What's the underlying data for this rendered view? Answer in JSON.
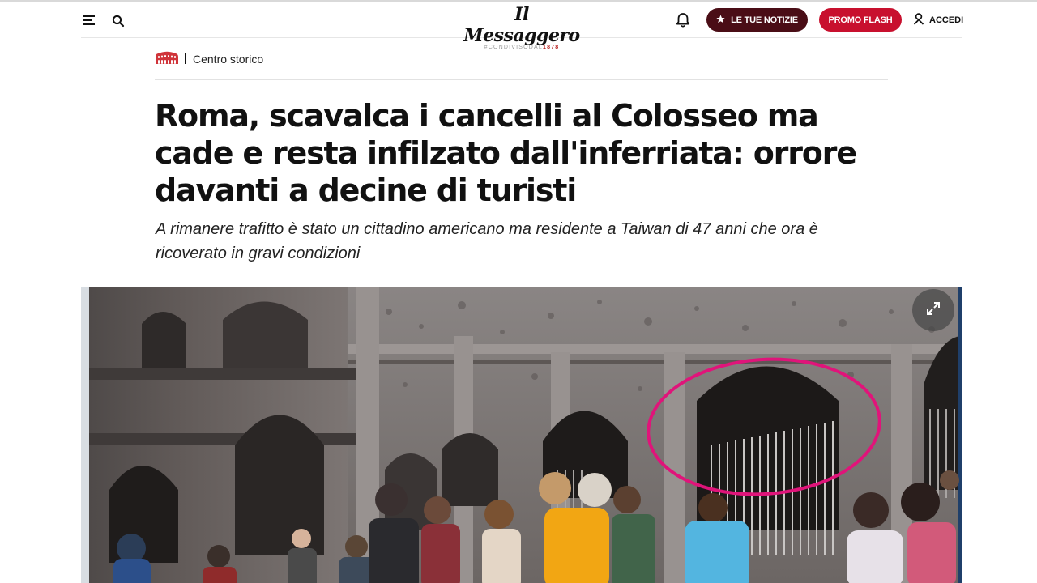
{
  "header": {
    "logo_title": "Il Messaggero",
    "logo_tagline_prefix": "#CONDIVISODAL",
    "logo_tagline_year": "1878",
    "btn_news_label": "LE TUE NOTIZIE",
    "btn_promo_label": "PROMO FLASH",
    "login_label": "ACCEDI",
    "icons": [
      "menu-icon",
      "search-icon",
      "bell-icon",
      "star-icon",
      "user-icon"
    ]
  },
  "section": {
    "label": "Centro storico",
    "icon": "colosseum-icon"
  },
  "article": {
    "headline": "Roma, scavalca i cancelli al Colosseo ma cade e resta infilzato dall'inferriata: orrore davanti a decine di turisti",
    "subtitle": "A rimanere trafitto è stato un cittadino americano ma residente a Taiwan di 47 anni che ora è ricoverato in gravi condizioni"
  },
  "image": {
    "expand_icon": "expand-icon"
  },
  "colors": {
    "news_button": "#4a0d16",
    "promo_button": "#c8102e",
    "highlight_circle": "#e0147a",
    "brand_red": "#b71c1c"
  }
}
